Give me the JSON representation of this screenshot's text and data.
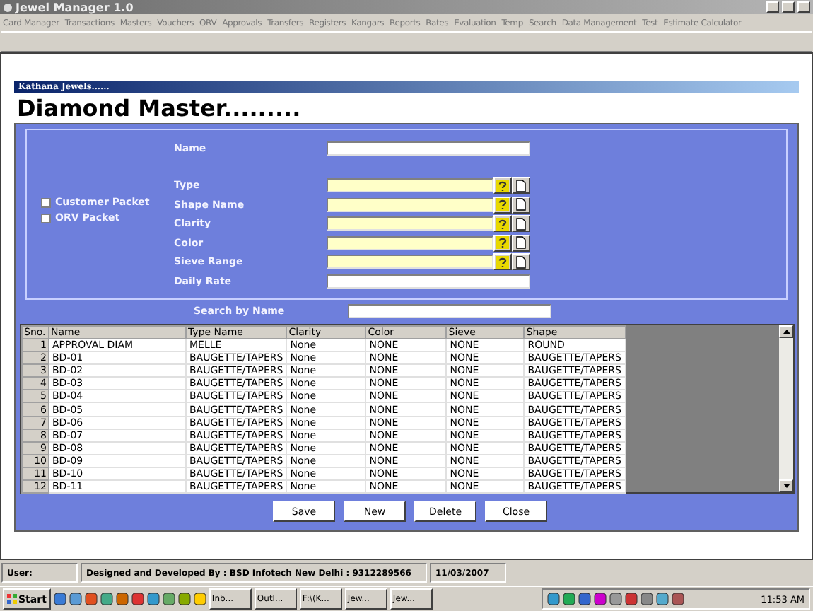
{
  "window": {
    "title": "Jewel Manager 1.0"
  },
  "menu": [
    "Card Manager",
    "Transactions",
    "Masters",
    "Vouchers",
    "ORV",
    "Approvals",
    "Transfers",
    "Registers",
    "Kangars",
    "Reports",
    "Rates",
    "Evaluation",
    "Temp",
    "Search",
    "Data Management",
    "Test",
    "Estimate Calculator"
  ],
  "form": {
    "company": "Kathana Jewels......",
    "heading": "Diamond Master.........",
    "name_label": "Name",
    "checkboxes": [
      {
        "label": "Customer Packet",
        "checked": false
      },
      {
        "label": "ORV Packet",
        "checked": false
      }
    ],
    "lookups": [
      {
        "label": "Type"
      },
      {
        "label": "Shape Name"
      },
      {
        "label": "Clarity"
      },
      {
        "label": "Color"
      },
      {
        "label": "Sieve Range"
      }
    ],
    "daily_rate_label": "Daily Rate",
    "search_label": "Search by  Name"
  },
  "table": {
    "columns": [
      "Sno.",
      "Name",
      "Type Name",
      "Clarity",
      "Color",
      "Sieve",
      "Shape"
    ],
    "rows": [
      [
        "1",
        "APPROVAL DIAM",
        "MELLE",
        "None",
        "NONE",
        "NONE",
        "ROUND"
      ],
      [
        "2",
        "BD-01",
        "BAUGETTE/TAPERS",
        "None",
        "NONE",
        "NONE",
        "BAUGETTE/TAPERS"
      ],
      [
        "3",
        "BD-02",
        "BAUGETTE/TAPERS",
        "None",
        "NONE",
        "NONE",
        "BAUGETTE/TAPERS"
      ],
      [
        "4",
        "BD-03",
        "BAUGETTE/TAPERS",
        "None",
        "NONE",
        "NONE",
        "BAUGETTE/TAPERS"
      ],
      [
        "5",
        "BD-04",
        "BAUGETTE/TAPERS",
        "None",
        "NONE",
        "NONE",
        "BAUGETTE/TAPERS"
      ],
      [
        "6",
        "BD-05",
        "BAUGETTE/TAPERS",
        "None",
        "NONE",
        "NONE",
        "BAUGETTE/TAPERS"
      ],
      [
        "7",
        "BD-06",
        "BAUGETTE/TAPERS",
        "None",
        "NONE",
        "NONE",
        "BAUGETTE/TAPERS"
      ],
      [
        "8",
        "BD-07",
        "BAUGETTE/TAPERS",
        "None",
        "NONE",
        "NONE",
        "BAUGETTE/TAPERS"
      ],
      [
        "9",
        "BD-08",
        "BAUGETTE/TAPERS",
        "None",
        "NONE",
        "NONE",
        "BAUGETTE/TAPERS"
      ],
      [
        "10",
        "BD-09",
        "BAUGETTE/TAPERS",
        "None",
        "NONE",
        "NONE",
        "BAUGETTE/TAPERS"
      ],
      [
        "11",
        "BD-10",
        "BAUGETTE/TAPERS",
        "None",
        "NONE",
        "NONE",
        "BAUGETTE/TAPERS"
      ],
      [
        "12",
        "BD-11",
        "BAUGETTE/TAPERS",
        "None",
        "NONE",
        "NONE",
        "BAUGETTE/TAPERS"
      ]
    ]
  },
  "buttons": [
    "Save",
    "New",
    "Delete",
    "Close"
  ],
  "status_bar": [
    "User:",
    "Designed and Developed By : BSD Infotech New Delhi : 9312289566",
    "11/03/2007"
  ],
  "taskbar": {
    "start": "Start",
    "tasks": [
      "Inb...",
      "Outl...",
      "F:\\(K...",
      "Jew...",
      "Jew..."
    ],
    "clock": "11:53 AM"
  }
}
